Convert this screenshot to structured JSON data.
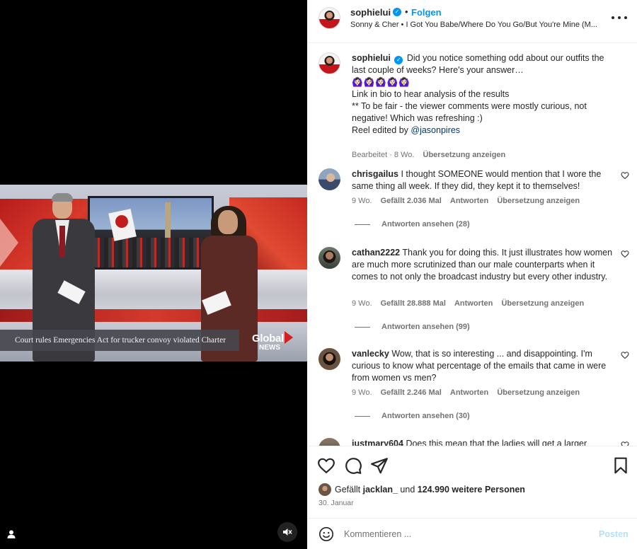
{
  "video": {
    "lower_third": "Court rules Emergencies Act for trucker convoy violated Charter",
    "logo_top": "Global",
    "logo_bottom": "NEWS",
    "icons": {
      "user_tag": "person-icon",
      "mute": "speaker-muted-icon"
    }
  },
  "header": {
    "username": "sophielui",
    "dot": "•",
    "follow_label": "Folgen",
    "audio": "Sonny & Cher • I Got You Babe/Where Do You Go/But You're Mine (M...",
    "more_icon": "more-horizontal-icon"
  },
  "caption": {
    "username": "sophielui",
    "lines": [
      "Did you notice something odd about our outfits the last couple of weeks? Here's your answer…",
      "🙆🏻‍♀️🙆🏻‍♀️🙆🏻‍♀️🙆🏻‍♀️🙆🏻‍♀️",
      "Link in bio to hear analysis of the results",
      "** To be fair - the viewer comments were mostly curious, not negative! Which was refreshing :)",
      "Reel edited by ",
      "@jasonpires"
    ],
    "meta_edited": "Bearbeitet · 8 Wo.",
    "meta_translate": "Übersetzung anzeigen"
  },
  "comments": [
    {
      "username": "chrisgailus",
      "text": "I thought SOMEONE would mention that I wore the same thing all week. If they did, they kept it to themselves!",
      "age": "9 Wo.",
      "likes": "Gefällt 2.036 Mal",
      "reply": "Antworten",
      "translate": "Übersetzung anzeigen",
      "view_replies": "Antworten ansehen (28)"
    },
    {
      "username": "cathan2222",
      "text": "Thank you for doing this. It just illustrates how women are much more scrutinized than our male counterparts when it comes to not only the broadcast industry but every other industry.",
      "age": "9 Wo.",
      "likes": "Gefällt 28.888 Mal",
      "reply": "Antworten",
      "translate": "Übersetzung anzeigen",
      "view_replies": "Antworten ansehen (99)"
    },
    {
      "username": "vanlecky",
      "text": "Wow, that is so interesting ... and disappointing. I'm curious to know what percentage of the emails that came in were from women vs men?",
      "age": "9 Wo.",
      "likes": "Gefällt 2.246 Mal",
      "reply": "Antworten",
      "translate": "Übersetzung anzeigen",
      "view_replies": "Antworten ansehen (30)"
    },
    {
      "username": "justmary604",
      "text": "Does this mean that the ladies will get a larger"
    }
  ],
  "actions": {
    "like_icon": "heart-icon",
    "comment_icon": "comment-bubble-icon",
    "share_icon": "paper-plane-icon",
    "save_icon": "bookmark-icon",
    "likes_prefix": "Gefällt ",
    "likes_user": "jacklan_",
    "likes_mid": " und ",
    "likes_count": "124.990 weitere Personen",
    "date": "30. Januar"
  },
  "comment_box": {
    "placeholder": "Kommentieren ...",
    "post_label": "Posten",
    "emoji_icon": "smiley-icon"
  },
  "colors": {
    "accent": "#0095f6",
    "post_disabled": "#b2dffc",
    "mention": "#00376b",
    "secondary_text": "#737373"
  }
}
